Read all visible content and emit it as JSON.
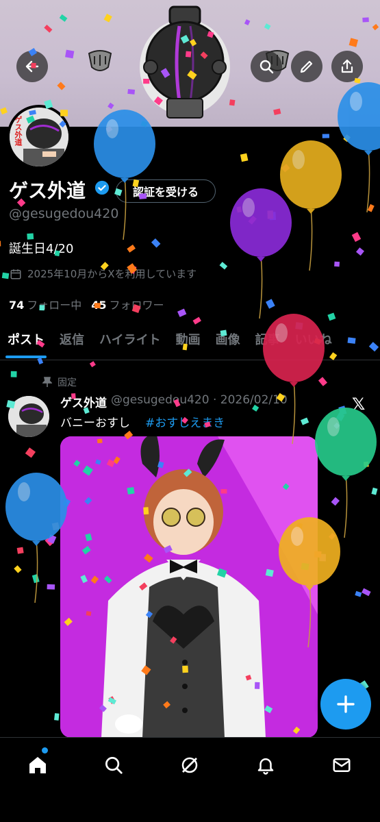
{
  "profile": {
    "display_name": "ゲス外道",
    "verify_button_label": "認証を受ける",
    "handle": "@gesugedou420",
    "bio": "誕生日4/20",
    "joined": "2025年10月からXを利用しています",
    "following_count": "74",
    "following_label": "フォロー中",
    "followers_count": "45",
    "followers_label": "フォロワー",
    "avatar_text": "ゲス外道"
  },
  "tabs": [
    "ポスト",
    "返信",
    "ハイライト",
    "動画",
    "画像",
    "記事",
    "いいね"
  ],
  "post": {
    "pinned_label": "固定",
    "author": "ゲス外道",
    "meta": "@gesugedou420 · 2026/02/10",
    "text": "バニーおすし",
    "hashtag": "#おすしえまき"
  },
  "icons": {
    "back": "back-arrow-icon",
    "search": "search-icon",
    "edit": "pencil-icon",
    "share": "share-icon",
    "verified": "verified-badge-icon",
    "calendar": "calendar-icon",
    "pin": "pin-icon",
    "x_logo": "x-logo-icon",
    "compose": "plus-icon",
    "nav": [
      "home-icon",
      "search-icon",
      "grok-icon",
      "bell-icon",
      "mail-icon"
    ]
  },
  "colors": {
    "accent": "#1d9bf0",
    "muted": "#71767b",
    "background": "#000000"
  },
  "balloons": [
    {
      "color": "#2b8fe8"
    },
    {
      "color": "#e5ae1e"
    },
    {
      "color": "#2b8fe8"
    },
    {
      "color": "#8a2bd8"
    },
    {
      "color": "#d8234f"
    },
    {
      "color": "#26c98a"
    },
    {
      "color": "#2b8fe8"
    },
    {
      "color": "#f0b020"
    }
  ]
}
